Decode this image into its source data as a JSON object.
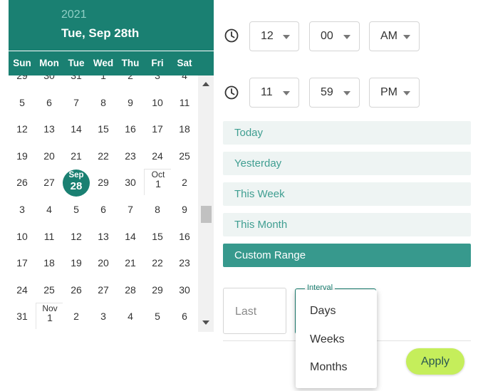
{
  "calendar": {
    "year": "2021",
    "selected_date_label": "Tue, Sep 28th",
    "weekdays": [
      "Sun",
      "Mon",
      "Tue",
      "Wed",
      "Thu",
      "Fri",
      "Sat"
    ],
    "rows": [
      [
        "29",
        "30",
        "31",
        "1",
        "2",
        "3",
        "4"
      ],
      [
        "5",
        "6",
        "7",
        "8",
        "9",
        "10",
        "11"
      ],
      [
        "12",
        "13",
        "14",
        "15",
        "16",
        "17",
        "18"
      ],
      [
        "19",
        "20",
        "21",
        "22",
        "23",
        "24",
        "25"
      ],
      [
        "26",
        "27",
        "28",
        "29",
        "30",
        "1",
        "2"
      ],
      [
        "3",
        "4",
        "5",
        "6",
        "7",
        "8",
        "9"
      ],
      [
        "10",
        "11",
        "12",
        "13",
        "14",
        "15",
        "16"
      ],
      [
        "17",
        "18",
        "19",
        "20",
        "21",
        "22",
        "23"
      ],
      [
        "24",
        "25",
        "26",
        "27",
        "28",
        "29",
        "30"
      ],
      [
        "31",
        "1",
        "2",
        "3",
        "4",
        "5",
        "6"
      ]
    ],
    "selected_month_label": "Sep",
    "selected_day": "28",
    "month_labels": {
      "oct": "Oct",
      "nov": "Nov"
    }
  },
  "start_time": {
    "hour": "12",
    "minute": "00",
    "meridiem": "AM"
  },
  "end_time": {
    "hour": "11",
    "minute": "59",
    "meridiem": "PM"
  },
  "ranges": [
    "Today",
    "Yesterday",
    "This Week",
    "This Month",
    "Custom Range"
  ],
  "active_range": "Custom Range",
  "interval": {
    "last_placeholder": "Last",
    "label": "Interval",
    "options": [
      "Days",
      "Weeks",
      "Months"
    ]
  },
  "apply_label": "Apply",
  "colors": {
    "accent": "#1a8072",
    "active_range": "#37998d",
    "apply": "#c5ee5b"
  }
}
